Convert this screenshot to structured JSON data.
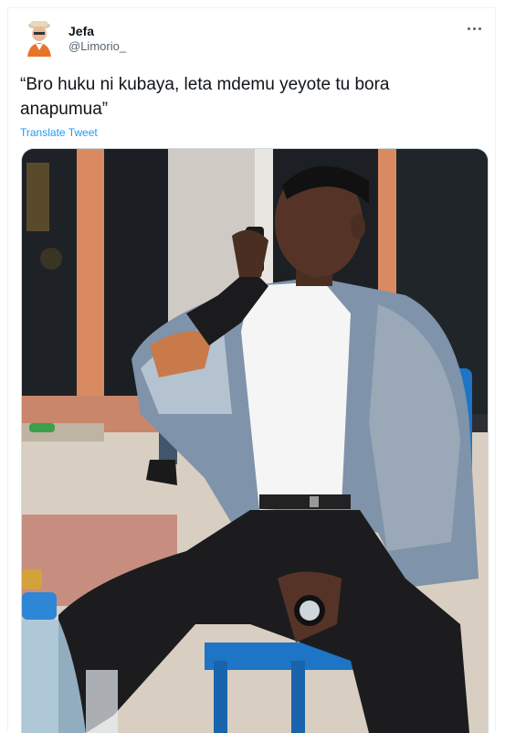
{
  "tweet": {
    "author_name": "Jefa",
    "author_handle": "@Limorio_",
    "text": "“Bro huku ni kubaya, leta mdemu yeyote tu bora anapumua”",
    "translate_label": "Translate Tweet"
  },
  "icons": {
    "more": "more-options-icon",
    "avatar": "avatar"
  },
  "colors": {
    "link": "#1d9bf0",
    "handle": "#536471",
    "text": "#0f1419"
  }
}
